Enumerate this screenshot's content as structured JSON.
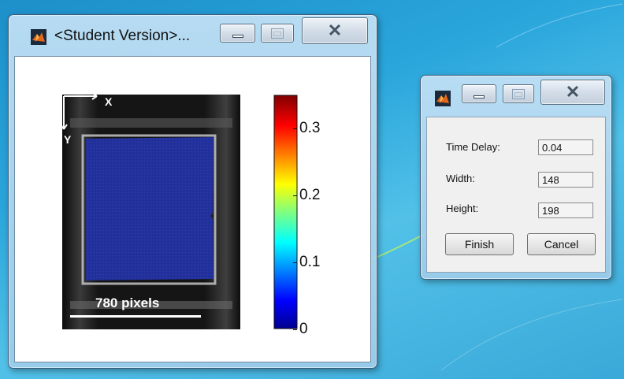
{
  "main_window": {
    "title": "<Student Version>...",
    "figure": {
      "axes_x_label": "X",
      "axes_y_label": "Y",
      "scale_bar_label": "780 pixels"
    },
    "colorbar": {
      "tick_labels": [
        "0.3",
        "0.2",
        "0.1",
        "0"
      ],
      "range": [
        0,
        0.35
      ],
      "colormap": "jet"
    }
  },
  "dialog": {
    "title": "",
    "fields": [
      {
        "label": "Time Delay:",
        "value": "0.04"
      },
      {
        "label": "Width:",
        "value": "148"
      },
      {
        "label": "Height:",
        "value": "198"
      }
    ],
    "finish_label": "Finish",
    "cancel_label": "Cancel"
  },
  "colors": {
    "overlay_blue": "#22309a",
    "accent_orange": "#e2661b"
  },
  "icons": [
    "matlab-icon",
    "minimize-icon",
    "maximize-icon",
    "close-icon"
  ]
}
